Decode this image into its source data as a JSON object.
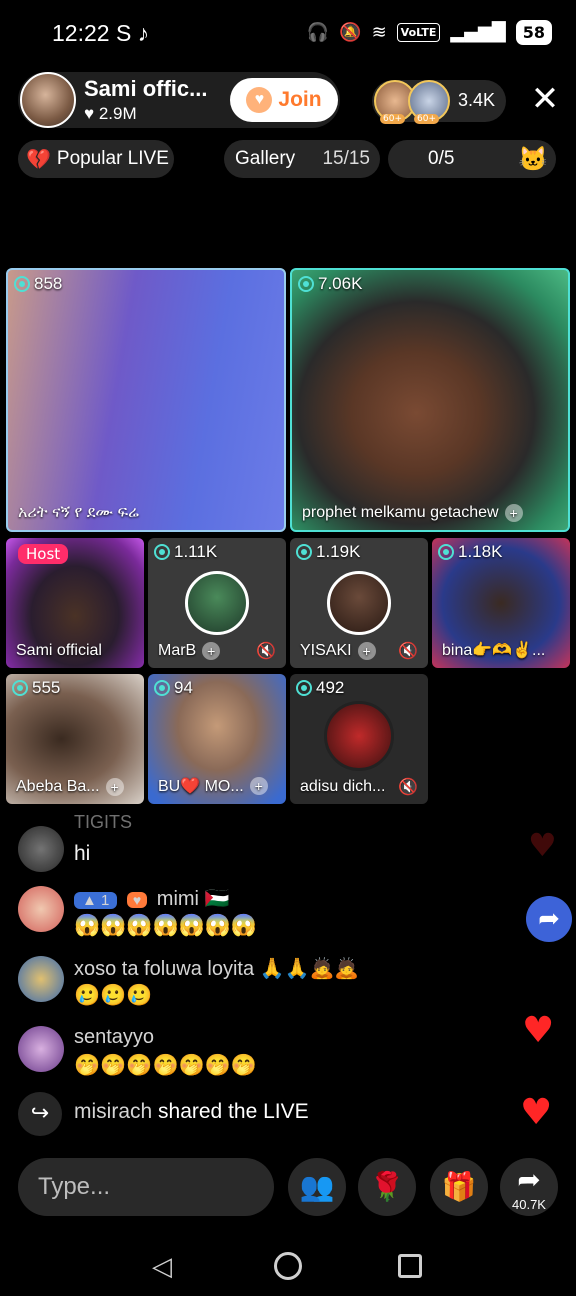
{
  "status_bar": {
    "time": "12:22",
    "app_icons": "S ♪",
    "volte": "VoLTE",
    "battery": "58"
  },
  "host": {
    "name": "Sami offic...",
    "likes": "2.9M",
    "join_label": "Join"
  },
  "viewers": {
    "count": "3.4K",
    "levels": [
      "60+",
      "60+"
    ]
  },
  "chips": {
    "popular": "Popular LIVE",
    "gallery": "Gallery",
    "gallery_count": "15/15",
    "slots": "0/5"
  },
  "tiles": {
    "t1": {
      "viewers": "858",
      "name": "አሪት ናኝ የ ደሙ ፍሬ"
    },
    "t2": {
      "viewers": "7.06K",
      "name": "prophet melkamu getachew"
    },
    "t3": {
      "host_tag": "Host",
      "name": "Sami official"
    },
    "t4": {
      "viewers": "1.11K",
      "name": "MarB"
    },
    "t5": {
      "viewers": "1.19K",
      "name": "YISAKI"
    },
    "t6": {
      "viewers": "1.18K",
      "name": "bina👉🫶✌️..."
    },
    "t7": {
      "viewers": "555",
      "name": "Abeba Ba..."
    },
    "t8": {
      "viewers": "94",
      "name": "BU❤️ MO..."
    },
    "t9": {
      "viewers": "492",
      "name": "adisu dich..."
    }
  },
  "comments": [
    {
      "name": "TIGITS",
      "text": "hi"
    },
    {
      "level": "1",
      "name": "mimi 🇵🇸",
      "text": "😱😱😱😱😱😱😱"
    },
    {
      "name": "xoso ta foluwa loyita 🙏🙏🙇🙇",
      "text": "🥲🥲🥲"
    },
    {
      "name": "sentayyo",
      "text": "🤭🤭🤭🤭🤭🤭🤭"
    }
  ],
  "share": {
    "user": "misirach",
    "text": "shared the LIVE"
  },
  "bottom": {
    "type_placeholder": "Type...",
    "share_count": "40.7K"
  },
  "colors": {
    "join": "#ff7a2d",
    "live_dot": "#4fe0d4",
    "host_tag": "#ff2d6a",
    "heart": "#ff2626"
  }
}
